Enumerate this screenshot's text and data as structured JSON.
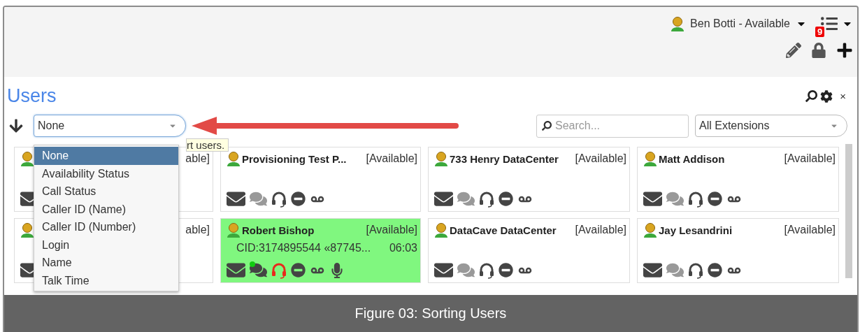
{
  "header": {
    "user": "Ben Botti - Available",
    "notification_count": "9"
  },
  "panel": {
    "title": "Users",
    "close": "×"
  },
  "toolbar": {
    "sort_select": {
      "value": "None",
      "expanded": true
    },
    "search": {
      "placeholder": "Search..."
    },
    "filter_select": {
      "value": "All Extensions"
    }
  },
  "sort_options": [
    {
      "label": "None",
      "selected": true
    },
    {
      "label": "Availability Status",
      "selected": false
    },
    {
      "label": "Call Status",
      "selected": false
    },
    {
      "label": "Caller ID (Name)",
      "selected": false
    },
    {
      "label": "Caller ID (Number)",
      "selected": false
    },
    {
      "label": "Login",
      "selected": false
    },
    {
      "label": "Name",
      "selected": false
    },
    {
      "label": "Talk Time",
      "selected": false
    }
  ],
  "tooltip": "rt users.",
  "cards": [
    {
      "status": "able]",
      "on_call": false,
      "icons": [
        {
          "kind": "mail"
        }
      ]
    },
    {
      "name": "Provisioning Test P...",
      "status": "[Available]",
      "on_call": false,
      "icons": [
        {
          "kind": "mail"
        },
        {
          "kind": "chat"
        },
        {
          "kind": "headset"
        },
        {
          "kind": "dnd"
        },
        {
          "kind": "voicemail"
        }
      ]
    },
    {
      "name": "733 Henry DataCenter",
      "status": "[Available]",
      "on_call": false,
      "icons": [
        {
          "kind": "mail"
        },
        {
          "kind": "chat"
        },
        {
          "kind": "headset"
        },
        {
          "kind": "dnd"
        },
        {
          "kind": "voicemail"
        }
      ]
    },
    {
      "name": "Matt Addison",
      "status": "[Available]",
      "on_call": false,
      "icons": [
        {
          "kind": "mail"
        },
        {
          "kind": "chat"
        },
        {
          "kind": "headset"
        },
        {
          "kind": "dnd"
        },
        {
          "kind": "voicemail"
        }
      ]
    },
    {
      "status": "able]",
      "on_call": false,
      "icons": [
        {
          "kind": "mail"
        }
      ]
    },
    {
      "name": "Robert Bishop",
      "status": "[Available]",
      "on_call": true,
      "caller_id": "CID:3174895544 «87745...",
      "talk_time": "06:03",
      "icons": [
        {
          "kind": "mail"
        },
        {
          "kind": "chat"
        },
        {
          "kind": "headset"
        },
        {
          "kind": "dnd"
        },
        {
          "kind": "voicemail"
        },
        {
          "kind": "mic"
        }
      ]
    },
    {
      "name": "DataCave DataCenter",
      "status": "[Available]",
      "on_call": false,
      "icons": [
        {
          "kind": "mail"
        },
        {
          "kind": "chat"
        },
        {
          "kind": "headset"
        },
        {
          "kind": "dnd"
        },
        {
          "kind": "voicemail"
        }
      ]
    },
    {
      "name": "Jay Lesandrini",
      "status": "[Available]",
      "on_call": false,
      "icons": [
        {
          "kind": "mail"
        },
        {
          "kind": "chat"
        },
        {
          "kind": "headset"
        },
        {
          "kind": "dnd"
        },
        {
          "kind": "voicemail"
        }
      ]
    }
  ],
  "caption": "Figure 03: Sorting Users"
}
